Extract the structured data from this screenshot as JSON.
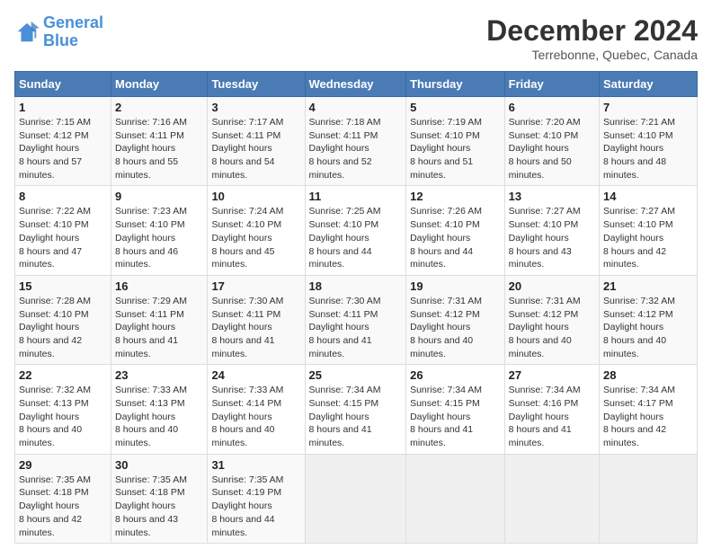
{
  "logo": {
    "line1": "General",
    "line2": "Blue"
  },
  "title": "December 2024",
  "subtitle": "Terrebonne, Quebec, Canada",
  "weekdays": [
    "Sunday",
    "Monday",
    "Tuesday",
    "Wednesday",
    "Thursday",
    "Friday",
    "Saturday"
  ],
  "weeks": [
    [
      {
        "num": "1",
        "sunrise": "7:15 AM",
        "sunset": "4:12 PM",
        "daylight": "8 hours and 57 minutes."
      },
      {
        "num": "2",
        "sunrise": "7:16 AM",
        "sunset": "4:11 PM",
        "daylight": "8 hours and 55 minutes."
      },
      {
        "num": "3",
        "sunrise": "7:17 AM",
        "sunset": "4:11 PM",
        "daylight": "8 hours and 54 minutes."
      },
      {
        "num": "4",
        "sunrise": "7:18 AM",
        "sunset": "4:11 PM",
        "daylight": "8 hours and 52 minutes."
      },
      {
        "num": "5",
        "sunrise": "7:19 AM",
        "sunset": "4:10 PM",
        "daylight": "8 hours and 51 minutes."
      },
      {
        "num": "6",
        "sunrise": "7:20 AM",
        "sunset": "4:10 PM",
        "daylight": "8 hours and 50 minutes."
      },
      {
        "num": "7",
        "sunrise": "7:21 AM",
        "sunset": "4:10 PM",
        "daylight": "8 hours and 48 minutes."
      }
    ],
    [
      {
        "num": "8",
        "sunrise": "7:22 AM",
        "sunset": "4:10 PM",
        "daylight": "8 hours and 47 minutes."
      },
      {
        "num": "9",
        "sunrise": "7:23 AM",
        "sunset": "4:10 PM",
        "daylight": "8 hours and 46 minutes."
      },
      {
        "num": "10",
        "sunrise": "7:24 AM",
        "sunset": "4:10 PM",
        "daylight": "8 hours and 45 minutes."
      },
      {
        "num": "11",
        "sunrise": "7:25 AM",
        "sunset": "4:10 PM",
        "daylight": "8 hours and 44 minutes."
      },
      {
        "num": "12",
        "sunrise": "7:26 AM",
        "sunset": "4:10 PM",
        "daylight": "8 hours and 44 minutes."
      },
      {
        "num": "13",
        "sunrise": "7:27 AM",
        "sunset": "4:10 PM",
        "daylight": "8 hours and 43 minutes."
      },
      {
        "num": "14",
        "sunrise": "7:27 AM",
        "sunset": "4:10 PM",
        "daylight": "8 hours and 42 minutes."
      }
    ],
    [
      {
        "num": "15",
        "sunrise": "7:28 AM",
        "sunset": "4:10 PM",
        "daylight": "8 hours and 42 minutes."
      },
      {
        "num": "16",
        "sunrise": "7:29 AM",
        "sunset": "4:11 PM",
        "daylight": "8 hours and 41 minutes."
      },
      {
        "num": "17",
        "sunrise": "7:30 AM",
        "sunset": "4:11 PM",
        "daylight": "8 hours and 41 minutes."
      },
      {
        "num": "18",
        "sunrise": "7:30 AM",
        "sunset": "4:11 PM",
        "daylight": "8 hours and 41 minutes."
      },
      {
        "num": "19",
        "sunrise": "7:31 AM",
        "sunset": "4:12 PM",
        "daylight": "8 hours and 40 minutes."
      },
      {
        "num": "20",
        "sunrise": "7:31 AM",
        "sunset": "4:12 PM",
        "daylight": "8 hours and 40 minutes."
      },
      {
        "num": "21",
        "sunrise": "7:32 AM",
        "sunset": "4:12 PM",
        "daylight": "8 hours and 40 minutes."
      }
    ],
    [
      {
        "num": "22",
        "sunrise": "7:32 AM",
        "sunset": "4:13 PM",
        "daylight": "8 hours and 40 minutes."
      },
      {
        "num": "23",
        "sunrise": "7:33 AM",
        "sunset": "4:13 PM",
        "daylight": "8 hours and 40 minutes."
      },
      {
        "num": "24",
        "sunrise": "7:33 AM",
        "sunset": "4:14 PM",
        "daylight": "8 hours and 40 minutes."
      },
      {
        "num": "25",
        "sunrise": "7:34 AM",
        "sunset": "4:15 PM",
        "daylight": "8 hours and 41 minutes."
      },
      {
        "num": "26",
        "sunrise": "7:34 AM",
        "sunset": "4:15 PM",
        "daylight": "8 hours and 41 minutes."
      },
      {
        "num": "27",
        "sunrise": "7:34 AM",
        "sunset": "4:16 PM",
        "daylight": "8 hours and 41 minutes."
      },
      {
        "num": "28",
        "sunrise": "7:34 AM",
        "sunset": "4:17 PM",
        "daylight": "8 hours and 42 minutes."
      }
    ],
    [
      {
        "num": "29",
        "sunrise": "7:35 AM",
        "sunset": "4:18 PM",
        "daylight": "8 hours and 42 minutes."
      },
      {
        "num": "30",
        "sunrise": "7:35 AM",
        "sunset": "4:18 PM",
        "daylight": "8 hours and 43 minutes."
      },
      {
        "num": "31",
        "sunrise": "7:35 AM",
        "sunset": "4:19 PM",
        "daylight": "8 hours and 44 minutes."
      },
      null,
      null,
      null,
      null
    ]
  ],
  "labels": {
    "sunrise": "Sunrise: ",
    "sunset": "Sunset: ",
    "daylight": "Daylight: "
  }
}
